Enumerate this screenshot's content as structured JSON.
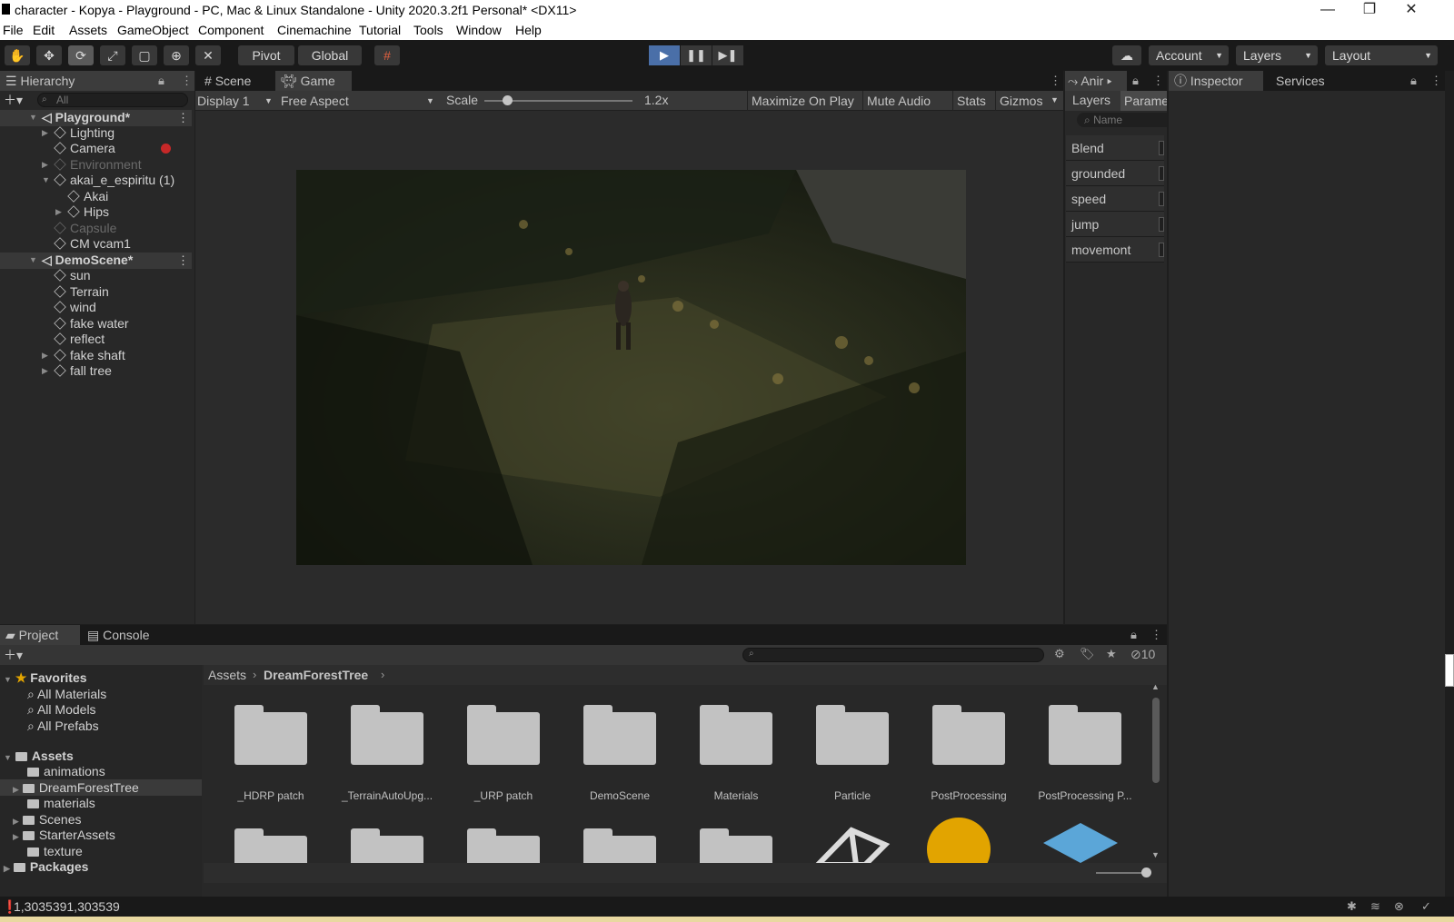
{
  "window": {
    "title": "character - Kopya - Playground - PC, Mac & Linux Standalone - Unity 2020.3.2f1 Personal* <DX11>",
    "controls": {
      "minimize": "—",
      "restore": "❐",
      "close": "✕"
    }
  },
  "menu": [
    "File",
    "Edit",
    "Assets",
    "GameObject",
    "Component",
    "Cinemachine",
    "Tutorial",
    "Tools",
    "Window",
    "Help"
  ],
  "toolbar": {
    "pivot": "Pivot",
    "global": "Global",
    "account": "Account",
    "layers": "Layers",
    "layout": "Layout",
    "play_mode": "playing"
  },
  "hierarchy": {
    "tab": "Hierarchy",
    "search_placeholder": "All",
    "items": [
      {
        "label": "Playground*",
        "kind": "scene"
      },
      {
        "label": "Lighting",
        "kind": "object"
      },
      {
        "label": "Camera",
        "kind": "object"
      },
      {
        "label": "Environment",
        "kind": "object",
        "dim": true
      },
      {
        "label": "akai_e_espiritu (1)",
        "kind": "object"
      },
      {
        "label": "Akai",
        "kind": "object"
      },
      {
        "label": "Hips",
        "kind": "object"
      },
      {
        "label": "Capsule",
        "kind": "object",
        "dim": true
      },
      {
        "label": "CM vcam1",
        "kind": "object"
      },
      {
        "label": "DemoScene*",
        "kind": "scene"
      },
      {
        "label": "sun",
        "kind": "object"
      },
      {
        "label": "Terrain",
        "kind": "object"
      },
      {
        "label": "wind",
        "kind": "object"
      },
      {
        "label": "fake water",
        "kind": "object"
      },
      {
        "label": "reflect",
        "kind": "object"
      },
      {
        "label": "fake shaft",
        "kind": "object"
      },
      {
        "label": "fall tree",
        "kind": "object"
      }
    ]
  },
  "game_view": {
    "tabs": [
      "Scene",
      "Game"
    ],
    "active_tab": "Game",
    "display": "Display 1",
    "aspect": "Free Aspect",
    "scale_label": "Scale",
    "scale_value": "1.2x",
    "scale_fraction": 0.06,
    "maximize": "Maximize On Play",
    "mute": "Mute Audio",
    "stats": "Stats",
    "gizmos": "Gizmos"
  },
  "animator": {
    "tab": "Anir",
    "subtabs": [
      "Layers",
      "Parame"
    ],
    "search_placeholder": "Name",
    "parameters": [
      "Blend",
      "grounded",
      "speed",
      "jump",
      "movemont"
    ]
  },
  "inspector": {
    "tabs": [
      "Inspector",
      "Services"
    ]
  },
  "project": {
    "tabs": [
      "Project",
      "Console"
    ],
    "hidden_count": "10",
    "favorites_label": "Favorites",
    "favorites": [
      "All Materials",
      "All Models",
      "All Prefabs"
    ],
    "assets_label": "Assets",
    "asset_folders": [
      "animations",
      "DreamForestTree",
      "materials",
      "Scenes",
      "StarterAssets",
      "texture"
    ],
    "packages_label": "Packages",
    "breadcrumb": [
      "Assets",
      "DreamForestTree"
    ],
    "grid_items": [
      "_HDRP patch",
      "_TerrainAutoUpg...",
      "_URP patch",
      "DemoScene",
      "Materials",
      "Particle",
      "PostProcessing",
      "PostProcessing P..."
    ]
  },
  "status_bar": {
    "message": "1,3035391,303539"
  },
  "colors": {
    "accent": "#4a6fa8",
    "sun_icon": "#e2a400",
    "prefab_icon": "#5ba6d8"
  }
}
